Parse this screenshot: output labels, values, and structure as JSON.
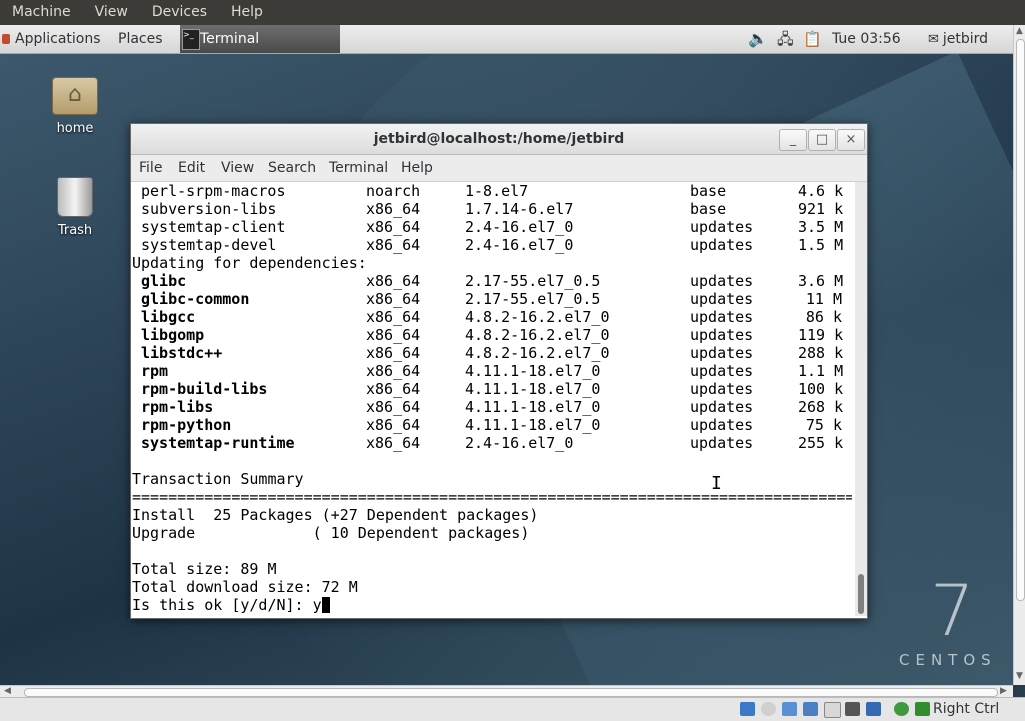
{
  "vbox_menu": [
    "Machine",
    "View",
    "Devices",
    "Help"
  ],
  "panel": {
    "applications": "Applications",
    "places": "Places",
    "task_terminal": "Terminal",
    "clock": "Tue 03:56",
    "user": "jetbird",
    "icons": [
      "volume-icon",
      "network-icon",
      "clipboard-icon",
      "user-icon"
    ]
  },
  "desktop": {
    "icons": [
      {
        "label": "home",
        "icon": "home-folder-icon"
      },
      {
        "label": "Trash",
        "icon": "trash-icon"
      }
    ],
    "watermark_number": "7",
    "watermark_word": "CENTOS"
  },
  "terminal": {
    "title": "jetbird@localhost:/home/jetbird",
    "window_buttons": {
      "minimize": "_",
      "maximize": "□",
      "close": "×"
    },
    "menu": [
      "File",
      "Edit",
      "View",
      "Search",
      "Terminal",
      "Help"
    ],
    "packages_top": [
      {
        "name": "perl-srpm-macros",
        "arch": "noarch",
        "version": "1-8.el7",
        "repo": "base",
        "size": "4.6 k"
      },
      {
        "name": "subversion-libs",
        "arch": "x86_64",
        "version": "1.7.14-6.el7",
        "repo": "base",
        "size": "921 k"
      },
      {
        "name": "systemtap-client",
        "arch": "x86_64",
        "version": "2.4-16.el7_0",
        "repo": "updates",
        "size": "3.5 M"
      },
      {
        "name": "systemtap-devel",
        "arch": "x86_64",
        "version": "2.4-16.el7_0",
        "repo": "updates",
        "size": "1.5 M"
      }
    ],
    "updating_header": "Updating for dependencies:",
    "packages_deps": [
      {
        "name": "glibc",
        "arch": "x86_64",
        "version": "2.17-55.el7_0.5",
        "repo": "updates",
        "size": "3.6 M"
      },
      {
        "name": "glibc-common",
        "arch": "x86_64",
        "version": "2.17-55.el7_0.5",
        "repo": "updates",
        "size": "11 M"
      },
      {
        "name": "libgcc",
        "arch": "x86_64",
        "version": "4.8.2-16.2.el7_0",
        "repo": "updates",
        "size": "86 k"
      },
      {
        "name": "libgomp",
        "arch": "x86_64",
        "version": "4.8.2-16.2.el7_0",
        "repo": "updates",
        "size": "119 k"
      },
      {
        "name": "libstdc++",
        "arch": "x86_64",
        "version": "4.8.2-16.2.el7_0",
        "repo": "updates",
        "size": "288 k"
      },
      {
        "name": "rpm",
        "arch": "x86_64",
        "version": "4.11.1-18.el7_0",
        "repo": "updates",
        "size": "1.1 M"
      },
      {
        "name": "rpm-build-libs",
        "arch": "x86_64",
        "version": "4.11.1-18.el7_0",
        "repo": "updates",
        "size": "100 k"
      },
      {
        "name": "rpm-libs",
        "arch": "x86_64",
        "version": "4.11.1-18.el7_0",
        "repo": "updates",
        "size": "268 k"
      },
      {
        "name": "rpm-python",
        "arch": "x86_64",
        "version": "4.11.1-18.el7_0",
        "repo": "updates",
        "size": "75 k"
      },
      {
        "name": "systemtap-runtime",
        "arch": "x86_64",
        "version": "2.4-16.el7_0",
        "repo": "updates",
        "size": "255 k"
      }
    ],
    "summary_header": "Transaction Summary",
    "separator": "=================================================================================================================",
    "install_line": "Install  25 Packages (+27 Dependent packages)",
    "upgrade_line": "Upgrade             ( 10 Dependent packages)",
    "total_size": "Total size: 89 M",
    "total_download": "Total download size: 72 M",
    "prompt": "Is this ok [y/d/N]: ",
    "typed": "y"
  },
  "statusbar": {
    "host_key": "Right Ctrl",
    "icons": [
      "hard-disk-icon",
      "optical-drive-icon",
      "usb-icon",
      "shared-folders-icon",
      "display-icon",
      "video-capture-icon",
      "virtualization-icon",
      "mouse-integration-icon",
      "keyboard-capture-icon"
    ]
  }
}
